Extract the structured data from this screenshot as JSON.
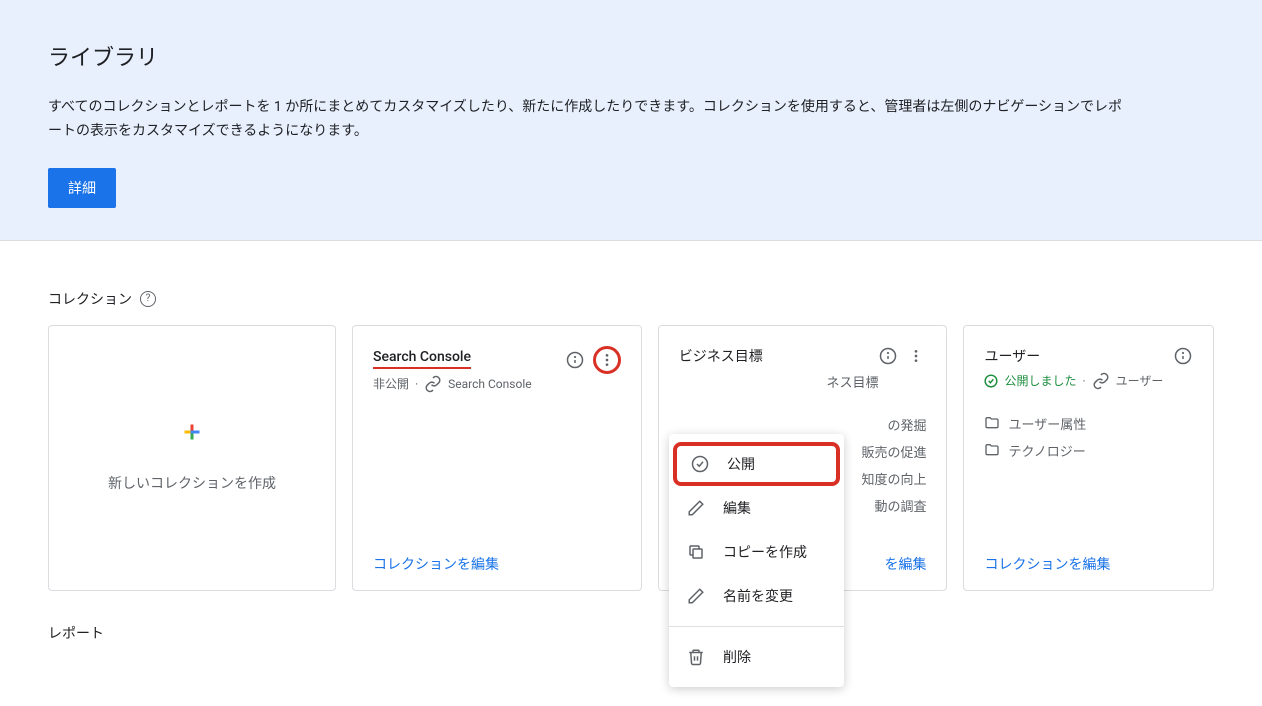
{
  "hero": {
    "title": "ライブラリ",
    "description": "すべてのコレクションとレポートを 1 か所にまとめてカスタマイズしたり、新たに作成したりできます。コレクションを使用すると、管理者は左側のナビゲーションでレポートの表示をカスタマイズできるようになります。",
    "button": "詳細"
  },
  "sections": {
    "collections_title": "コレクション",
    "reports_title": "レポート"
  },
  "create_card": {
    "label": "新しいコレクションを作成"
  },
  "cards": [
    {
      "title": "Search Console",
      "status": "非公開",
      "linked": "Search Console",
      "edit": "コレクションを編集"
    },
    {
      "title": "ビジネス目標",
      "status": "",
      "linked": "ネス目標",
      "items": [
        "の発掘",
        "販売の促進",
        "知度の向上",
        "動の調査"
      ],
      "edit": "を編集"
    },
    {
      "title": "ユーザー",
      "status": "公開しました",
      "linked": "ユーザー",
      "items": [
        "ユーザー属性",
        "テクノロジー"
      ],
      "edit": "コレクションを編集"
    }
  ],
  "menu": {
    "publish": "公開",
    "edit": "編集",
    "copy": "コピーを作成",
    "rename": "名前を変更",
    "delete": "削除"
  }
}
